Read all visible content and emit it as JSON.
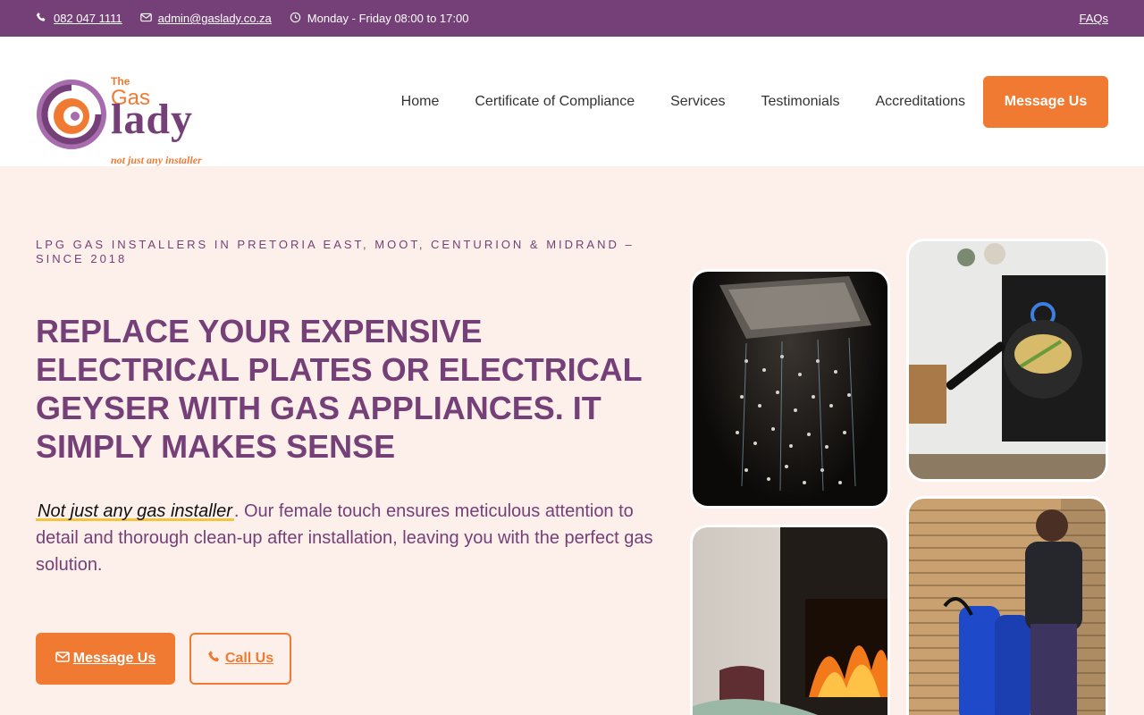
{
  "topbar": {
    "phone": "082 047 1111",
    "email": "admin@gaslady.co.za",
    "hours": "Monday - Friday 08:00 to 17:00",
    "faqs": "FAQs"
  },
  "logo": {
    "the": "The",
    "gas": "Gas",
    "lady": "lady",
    "tagline": "not just any installer"
  },
  "nav": {
    "items": [
      "Home",
      "Certificate of Compliance",
      "Services",
      "Testimonials",
      "Accreditations"
    ],
    "cta": "Message Us"
  },
  "hero": {
    "eyebrow": "LPG GAS INSTALLERS IN PRETORIA EAST, MOOT, CENTURION & MIDRAND – SINCE 2018",
    "headline": "REPLACE YOUR EXPENSIVE ELECTRICAL PLATES OR ELECTRICAL GEYSER WITH GAS APPLIANCES. IT SIMPLY MAKES SENSE",
    "lead_highlight": "Not just any gas installer",
    "lead_rest": ". Our female touch ensures meticulous attention to detail and thorough clean-up after installation, leaving you with the perfect gas solution.",
    "btn_message": "Message Us",
    "btn_call": "Call Us"
  },
  "colors": {
    "purple": "#754078",
    "orange": "#f07a32",
    "cream": "#fdf0ea",
    "highlight": "#f6c33c"
  },
  "icons": [
    "phone-icon",
    "email-icon",
    "clock-icon",
    "envelope-icon",
    "phone-call-icon"
  ]
}
